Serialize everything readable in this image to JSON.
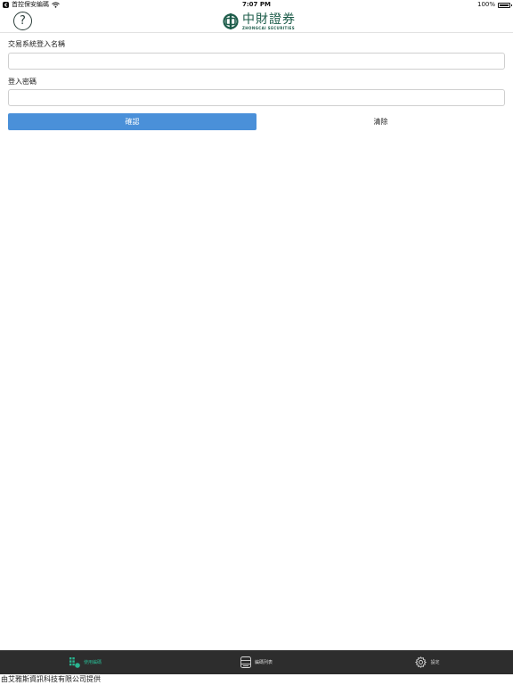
{
  "status_bar": {
    "back_app": "首控保安編碼",
    "time": "7:07 PM",
    "battery": "100%"
  },
  "header": {
    "help_symbol": "?",
    "brand_name": "中財證券",
    "brand_sub": "ZHONGCAI SECURITIES",
    "brand_color": "#1d5c4a"
  },
  "form": {
    "username_label": "交易系統登入名稱",
    "username_value": "",
    "password_label": "登入密碼",
    "password_value": "",
    "confirm_label": "確認",
    "clear_label": "清除",
    "confirm_color": "#4a90d9"
  },
  "tabs": [
    {
      "label": "使用編碼",
      "icon": "grid-key-icon",
      "active": true
    },
    {
      "label": "編碼列表",
      "icon": "list-icon",
      "active": false
    },
    {
      "label": "設定",
      "icon": "gear-icon",
      "active": false
    }
  ],
  "footer": "由艾雅斯資訊科技有限公司提供"
}
